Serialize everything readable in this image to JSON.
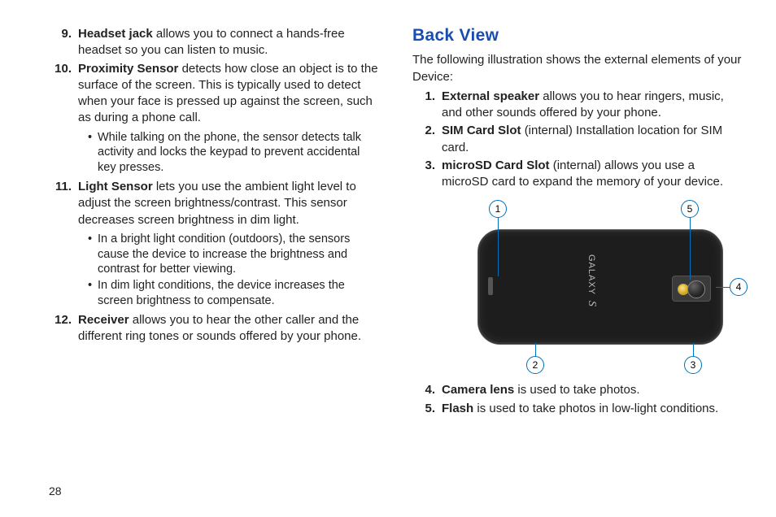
{
  "page_number": "28",
  "left": {
    "items": [
      {
        "num": "9.",
        "term": "Headset jack",
        "desc": "allows you to connect a hands-free headset so you can listen to music.",
        "bullets": []
      },
      {
        "num": "10.",
        "term": "Proximity Sensor",
        "desc": "detects how close an object is to the surface of the screen. This is typically used to detect when your face is pressed up against the screen, such as during a phone call.",
        "bullets": [
          "While talking on the phone, the sensor detects talk activity and locks the keypad to prevent accidental key presses."
        ]
      },
      {
        "num": "11.",
        "term": "Light Sensor",
        "desc": "lets you use the ambient light level to adjust the screen brightness/contrast. This sensor decreases screen brightness in dim light.",
        "bullets": [
          "In a bright light condition (outdoors), the sensors cause the device to increase the brightness and contrast for better viewing.",
          "In dim light conditions, the device increases the screen brightness to compensate."
        ]
      },
      {
        "num": "12.",
        "term": "Receiver",
        "desc": "allows you to hear the other caller and the different ring tones or sounds offered by your phone.",
        "bullets": []
      }
    ]
  },
  "right": {
    "title": "Back View",
    "intro": "The following illustration shows the external elements of your Device:",
    "items_top": [
      {
        "num": "1.",
        "term": "External speaker",
        "desc": "allows you to hear ringers, music, and other sounds offered by your phone."
      },
      {
        "num": "2.",
        "term": "SIM Card Slot",
        "desc": "(internal) Installation location for SIM card."
      },
      {
        "num": "3.",
        "term": "microSD Card Slot",
        "desc": "(internal) allows you use a microSD card to expand the memory of your device."
      }
    ],
    "items_bottom": [
      {
        "num": "4.",
        "term": "Camera lens",
        "desc": "is used to take photos."
      },
      {
        "num": "5.",
        "term": "Flash",
        "desc": "is used to take photos in low-light conditions."
      }
    ],
    "callouts": {
      "c1": "1",
      "c2": "2",
      "c3": "3",
      "c4": "4",
      "c5": "5"
    },
    "brand": {
      "name": "GALAXY",
      "suffix": "S"
    }
  }
}
